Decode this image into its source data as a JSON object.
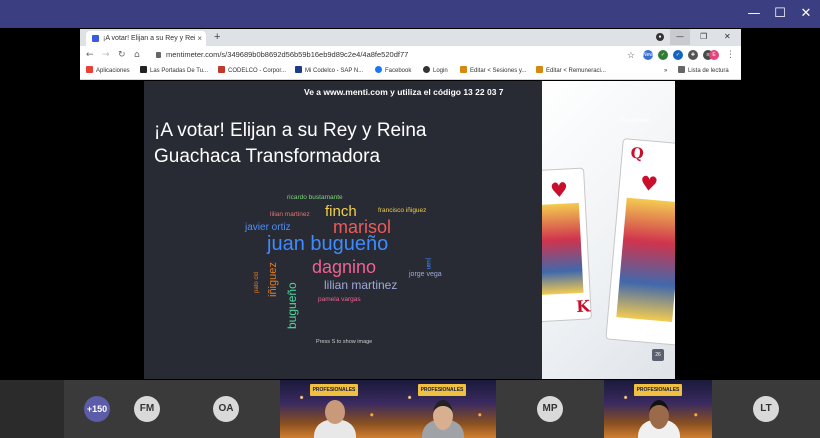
{
  "window": {
    "minimize": "—",
    "maximize": "☐",
    "close": "✕"
  },
  "browser": {
    "tab_title": "¡A votar! Elijan a su Rey y Reina G",
    "tab_close": "×",
    "new_tab": "+",
    "url": "mentimeter.com/s/349689b0b8692d56b59b16eb9d89c2e4/4a8fe520df77",
    "profile_initial": "E",
    "ext_new_badge": "New",
    "bookmarks": [
      {
        "label": "Aplicaciones",
        "color": "#e94235"
      },
      {
        "label": "Las Portadas De Tu...",
        "color": "#222222"
      },
      {
        "label": "CODELCO - Corpor...",
        "color": "#c0392b"
      },
      {
        "label": "Mi Codelco - SAP N...",
        "color": "#1e3a8a"
      },
      {
        "label": "Facebook",
        "color": "#1877f2"
      },
      {
        "label": "Login",
        "color": "#333333"
      },
      {
        "label": "Editar < Sesiones y...",
        "color": "#d68910"
      },
      {
        "label": "Editar < Remuneraci...",
        "color": "#d68910"
      }
    ],
    "bookmarks_more": "»",
    "reading_list": "Lista de lectura"
  },
  "slide": {
    "instruction": "Ve a www.menti.com y utiliza el código 13 22 03 7",
    "title_line1": "¡A votar! Elijan a su Rey y Reina",
    "title_line2": "Guachaca Transformadora",
    "press_hint": "Press S to show image",
    "words": [
      {
        "text": "ricardo bustamante",
        "color": "#7ad67a"
      },
      {
        "text": "finch",
        "color": "#f2d04b"
      },
      {
        "text": "francisco iñiguez",
        "color": "#f2d04b"
      },
      {
        "text": "lilian martinez",
        "color": "#e57373"
      },
      {
        "text": "marisol",
        "color": "#ef5a5a"
      },
      {
        "text": "javier ortiz",
        "color": "#4f8ef7"
      },
      {
        "text": "juan bugueño",
        "color": "#3d8bff"
      },
      {
        "text": "juan",
        "color": "#3d8bff"
      },
      {
        "text": "dagnino",
        "color": "#f06292"
      },
      {
        "text": "pato cid",
        "color": "#e67e22"
      },
      {
        "text": "iñiguez",
        "color": "#e67e22"
      },
      {
        "text": "jorge vega",
        "color": "#9fa8da"
      },
      {
        "text": "lilian martinez",
        "color": "#9fa8da"
      },
      {
        "text": "bugueño",
        "color": "#4cd9a0"
      },
      {
        "text": "pamela vargas",
        "color": "#f06292"
      }
    ]
  },
  "cards": {
    "queen_rank": "Q",
    "king_rank": "K",
    "suit": "♥",
    "brand": "Mentimeter",
    "chat_count": "26"
  },
  "participants": {
    "more_count": "+150",
    "tiles": [
      {
        "initials": "FM"
      },
      {
        "initials": "OA"
      },
      {
        "initials": "MP"
      },
      {
        "initials": "LT"
      }
    ],
    "video_banner": "PROFESIONALES"
  }
}
